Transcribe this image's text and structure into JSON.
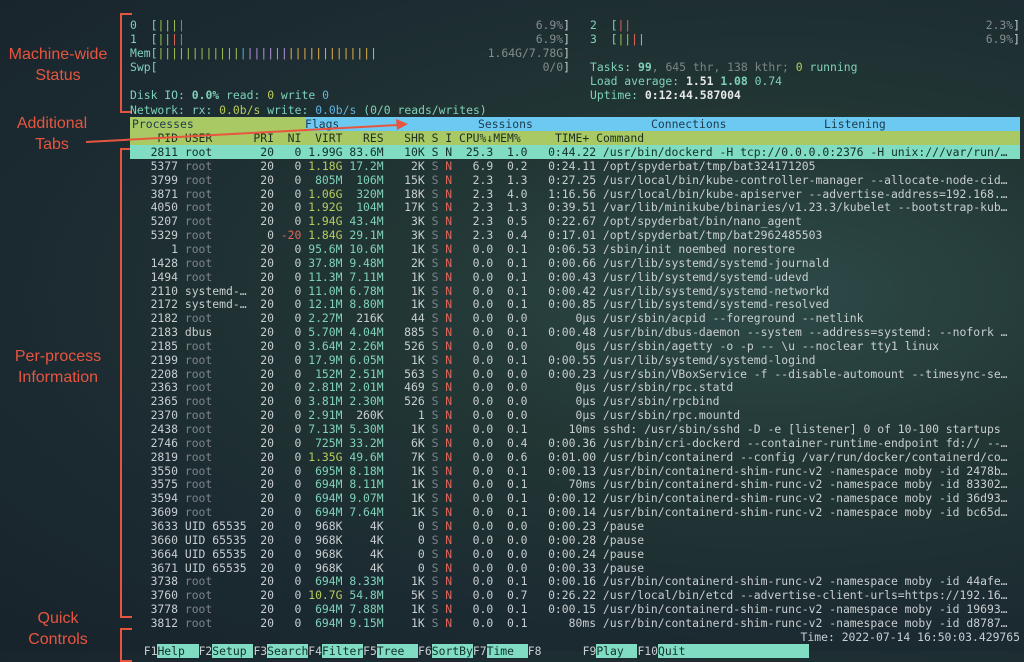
{
  "annotations": {
    "machine_wide": [
      "Machine-wide",
      "Status"
    ],
    "tabs": [
      "Additional",
      "Tabs"
    ],
    "per_process": [
      "Per-process",
      "Information"
    ],
    "quick": [
      "Quick",
      "Controls"
    ],
    "color": "#e8553f"
  },
  "meters": {
    "cpus": [
      {
        "label": "0",
        "value": "6.9%",
        "bars": [
          "g",
          "g",
          "g",
          "r"
        ]
      },
      {
        "label": "1",
        "value": "6.9%",
        "bars": [
          "g",
          "g",
          "r",
          "r"
        ]
      },
      {
        "label": "2",
        "value": "2.3%",
        "bars": [
          "r",
          "r"
        ]
      },
      {
        "label": "3",
        "value": "6.9%",
        "bars": [
          "g",
          "g",
          "r",
          "t"
        ]
      }
    ],
    "mem": {
      "label": "Mem",
      "value": "1.64G/7.78G",
      "bars": {
        "g": 12,
        "b": 1,
        "p": 6,
        "o": 13
      }
    },
    "swp": {
      "label": "Swp",
      "value": "0/0"
    },
    "disk": {
      "label": "Disk IO:",
      "pct": "0.0%",
      "read_label": "read:",
      "read": "0",
      "write_label": "write",
      "write": "0"
    },
    "network": {
      "label": "Network:",
      "rx_label": "rx:",
      "rx": "0.0b/s",
      "write_label": "write:",
      "write": "0.0b/s",
      "rw": "(0/0 reads/writes)"
    },
    "tasks": {
      "label": "Tasks:",
      "count": "99",
      "threads": ", 645 thr, 138 kthr;",
      "running": "0",
      "running_label": "running"
    },
    "load": {
      "label": "Load average:",
      "l1": "1.51",
      "l5": "1.08",
      "l15": "0.74"
    },
    "uptime": {
      "label": "Uptime:",
      "value": "0:12:44.587004"
    }
  },
  "tabs": [
    "Processes",
    "Flags",
    "Sessions",
    "Connections",
    "Listening"
  ],
  "columns": [
    "PID",
    "USER",
    "PRI",
    "NI",
    "VIRT",
    "RES",
    "SHR",
    "S",
    "I",
    "CPU%↓",
    "MEM%",
    "TIME+",
    "Command"
  ],
  "selected_pid": "2811",
  "processes": [
    [
      "2811",
      "root",
      "20",
      "0",
      "1.99G",
      "83.6M",
      "10K",
      "S",
      "N",
      "25.3",
      "1.0",
      "0:44.22",
      "/usr/bin/dockerd -H tcp://0.0.0.0:2376 -H unix:///var/run/…"
    ],
    [
      "5377",
      "root",
      "20",
      "0",
      "1.18G",
      "17.2M",
      "2K",
      "S",
      "N",
      "6.9",
      "0.2",
      "0:24.11",
      "/opt/spyderbat/tmp/bat324171205"
    ],
    [
      "3799",
      "root",
      "20",
      "0",
      "805M",
      "106M",
      "15K",
      "S",
      "N",
      "2.3",
      "1.3",
      "0:27.25",
      "/usr/local/bin/kube-controller-manager --allocate-node-cid…"
    ],
    [
      "3871",
      "root",
      "20",
      "0",
      "1.06G",
      "320M",
      "18K",
      "S",
      "N",
      "2.3",
      "4.0",
      "1:16.56",
      "/usr/local/bin/kube-apiserver --advertise-address=192.168.…"
    ],
    [
      "4050",
      "root",
      "20",
      "0",
      "1.92G",
      "104M",
      "17K",
      "S",
      "N",
      "2.3",
      "1.3",
      "0:39.51",
      "/var/lib/minikube/binaries/v1.23.3/kubelet --bootstrap-kub…"
    ],
    [
      "5207",
      "root",
      "20",
      "0",
      "1.94G",
      "43.4M",
      "3K",
      "S",
      "N",
      "2.3",
      "0.5",
      "0:22.67",
      "/opt/spyderbat/bin/nano_agent"
    ],
    [
      "5329",
      "root",
      "0",
      "-20",
      "1.84G",
      "29.1M",
      "3K",
      "S",
      "N",
      "2.3",
      "0.4",
      "0:17.01",
      "/opt/spyderbat/tmp/bat2962485503"
    ],
    [
      "1",
      "root",
      "20",
      "0",
      "95.6M",
      "10.6M",
      "1K",
      "S",
      "N",
      "0.0",
      "0.1",
      "0:06.53",
      "/sbin/init noembed norestore"
    ],
    [
      "1428",
      "root",
      "20",
      "0",
      "37.8M",
      "9.48M",
      "2K",
      "S",
      "N",
      "0.0",
      "0.1",
      "0:00.66",
      "/usr/lib/systemd/systemd-journald"
    ],
    [
      "1494",
      "root",
      "20",
      "0",
      "11.3M",
      "7.11M",
      "1K",
      "S",
      "N",
      "0.0",
      "0.1",
      "0:00.43",
      "/usr/lib/systemd/systemd-udevd"
    ],
    [
      "2110",
      "systemd-…",
      "20",
      "0",
      "11.0M",
      "6.78M",
      "1K",
      "S",
      "N",
      "0.0",
      "0.1",
      "0:00.42",
      "/usr/lib/systemd/systemd-networkd"
    ],
    [
      "2172",
      "systemd-…",
      "20",
      "0",
      "12.1M",
      "8.80M",
      "1K",
      "S",
      "N",
      "0.0",
      "0.1",
      "0:00.85",
      "/usr/lib/systemd/systemd-resolved"
    ],
    [
      "2182",
      "root",
      "20",
      "0",
      "2.27M",
      "216K",
      "44",
      "S",
      "N",
      "0.0",
      "0.0",
      "0μs",
      "/usr/sbin/acpid --foreground --netlink"
    ],
    [
      "2183",
      "dbus",
      "20",
      "0",
      "5.70M",
      "4.04M",
      "885",
      "S",
      "N",
      "0.0",
      "0.1",
      "0:00.48",
      "/usr/bin/dbus-daemon --system --address=systemd: --nofork …"
    ],
    [
      "2185",
      "root",
      "20",
      "0",
      "3.64M",
      "2.26M",
      "526",
      "S",
      "N",
      "0.0",
      "0.0",
      "0μs",
      "/usr/sbin/agetty -o -p -- \\u --noclear tty1 linux"
    ],
    [
      "2199",
      "root",
      "20",
      "0",
      "17.9M",
      "6.05M",
      "1K",
      "S",
      "N",
      "0.0",
      "0.1",
      "0:00.55",
      "/usr/lib/systemd/systemd-logind"
    ],
    [
      "2208",
      "root",
      "20",
      "0",
      "152M",
      "2.51M",
      "563",
      "S",
      "N",
      "0.0",
      "0.0",
      "0:00.23",
      "/usr/sbin/VBoxService -f --disable-automount --timesync-se…"
    ],
    [
      "2363",
      "root",
      "20",
      "0",
      "2.81M",
      "2.01M",
      "469",
      "S",
      "N",
      "0.0",
      "0.0",
      "0μs",
      "/usr/sbin/rpc.statd"
    ],
    [
      "2365",
      "root",
      "20",
      "0",
      "3.81M",
      "2.30M",
      "526",
      "S",
      "N",
      "0.0",
      "0.0",
      "0μs",
      "/usr/sbin/rpcbind"
    ],
    [
      "2370",
      "root",
      "20",
      "0",
      "2.91M",
      "260K",
      "1",
      "S",
      "N",
      "0.0",
      "0.0",
      "0μs",
      "/usr/sbin/rpc.mountd"
    ],
    [
      "2438",
      "root",
      "20",
      "0",
      "7.13M",
      "5.30M",
      "1K",
      "S",
      "N",
      "0.0",
      "0.1",
      "10ms",
      "sshd: /usr/sbin/sshd -D -e [listener] 0 of 10-100 startups"
    ],
    [
      "2746",
      "root",
      "20",
      "0",
      "725M",
      "33.2M",
      "6K",
      "S",
      "N",
      "0.0",
      "0.4",
      "0:00.36",
      "/usr/bin/cri-dockerd --container-runtime-endpoint fd:// --…"
    ],
    [
      "2819",
      "root",
      "20",
      "0",
      "1.35G",
      "49.6M",
      "7K",
      "S",
      "N",
      "0.0",
      "0.6",
      "0:01.00",
      "/usr/bin/containerd --config /var/run/docker/containerd/co…"
    ],
    [
      "3550",
      "root",
      "20",
      "0",
      "695M",
      "8.18M",
      "1K",
      "S",
      "N",
      "0.0",
      "0.1",
      "0:00.13",
      "/usr/bin/containerd-shim-runc-v2 -namespace moby -id 2478b…"
    ],
    [
      "3575",
      "root",
      "20",
      "0",
      "694M",
      "8.11M",
      "1K",
      "S",
      "N",
      "0.0",
      "0.1",
      "70ms",
      "/usr/bin/containerd-shim-runc-v2 -namespace moby -id 83302…"
    ],
    [
      "3594",
      "root",
      "20",
      "0",
      "694M",
      "9.07M",
      "1K",
      "S",
      "N",
      "0.0",
      "0.1",
      "0:00.12",
      "/usr/bin/containerd-shim-runc-v2 -namespace moby -id 36d93…"
    ],
    [
      "3609",
      "root",
      "20",
      "0",
      "694M",
      "7.64M",
      "1K",
      "S",
      "N",
      "0.0",
      "0.1",
      "0:00.14",
      "/usr/bin/containerd-shim-runc-v2 -namespace moby -id bc65d…"
    ],
    [
      "3633",
      "UID 65535",
      "20",
      "0",
      "968K",
      "4K",
      "0",
      "S",
      "N",
      "0.0",
      "0.0",
      "0:00.23",
      "/pause"
    ],
    [
      "3660",
      "UID 65535",
      "20",
      "0",
      "968K",
      "4K",
      "0",
      "S",
      "N",
      "0.0",
      "0.0",
      "0:00.28",
      "/pause"
    ],
    [
      "3664",
      "UID 65535",
      "20",
      "0",
      "968K",
      "4K",
      "0",
      "S",
      "N",
      "0.0",
      "0.0",
      "0:00.24",
      "/pause"
    ],
    [
      "3671",
      "UID 65535",
      "20",
      "0",
      "968K",
      "4K",
      "0",
      "S",
      "N",
      "0.0",
      "0.0",
      "0:00.33",
      "/pause"
    ],
    [
      "3738",
      "root",
      "20",
      "0",
      "694M",
      "8.33M",
      "1K",
      "S",
      "N",
      "0.0",
      "0.1",
      "0:00.16",
      "/usr/bin/containerd-shim-runc-v2 -namespace moby -id 44afe…"
    ],
    [
      "3760",
      "root",
      "20",
      "0",
      "10.7G",
      "54.8M",
      "5K",
      "S",
      "N",
      "0.0",
      "0.7",
      "0:26.22",
      "/usr/local/bin/etcd --advertise-client-urls=https://192.16…"
    ],
    [
      "3778",
      "root",
      "20",
      "0",
      "694M",
      "7.88M",
      "1K",
      "S",
      "N",
      "0.0",
      "0.1",
      "0:00.15",
      "/usr/bin/containerd-shim-runc-v2 -namespace moby -id 19693…"
    ],
    [
      "3812",
      "root",
      "20",
      "0",
      "694M",
      "9.15M",
      "1K",
      "S",
      "N",
      "0.0",
      "0.1",
      "80ms",
      "/usr/bin/containerd-shim-runc-v2 -namespace moby -id d8787…"
    ]
  ],
  "function_keys": [
    {
      "key": "F1",
      "label": "Help"
    },
    {
      "key": "F2",
      "label": "Setup"
    },
    {
      "key": "F3",
      "label": "Search"
    },
    {
      "key": "F4",
      "label": "Filter"
    },
    {
      "key": "F5",
      "label": "Tree"
    },
    {
      "key": "F6",
      "label": "SortBy"
    },
    {
      "key": "F7",
      "label": "Time"
    },
    {
      "key": "F8",
      "label": ""
    },
    {
      "key": "F9",
      "label": "Play"
    },
    {
      "key": "F10",
      "label": "Quit"
    }
  ],
  "clock": "Time: 2022-07-14 16:50:03.429765",
  "colors": {
    "selected_row": "#80dcc2",
    "tab_active": "#a9c964",
    "tab_bar": "#6ccaf2",
    "accent": "#7fd1b9"
  }
}
